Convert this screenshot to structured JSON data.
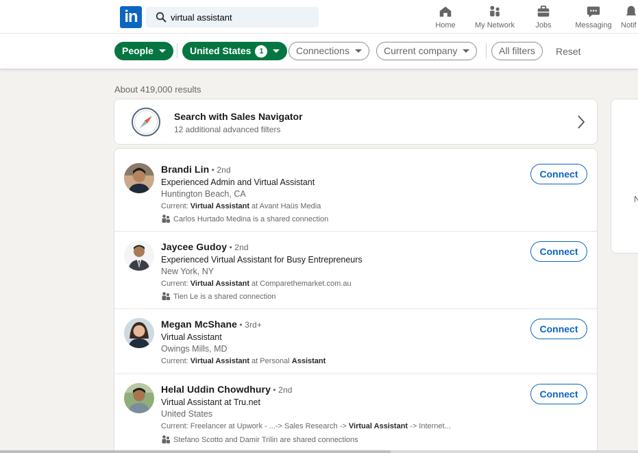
{
  "nav": {
    "logo": "in",
    "search_value": "virtual assistant",
    "items": [
      {
        "label": "Home",
        "icon": "home-icon"
      },
      {
        "label": "My Network",
        "icon": "network-icon"
      },
      {
        "label": "Jobs",
        "icon": "briefcase-icon"
      },
      {
        "label": "Messaging",
        "icon": "messaging-icon"
      },
      {
        "label": "Notif",
        "icon": "bell-icon"
      }
    ]
  },
  "filters": {
    "people": "People",
    "location": "United States",
    "location_count": "1",
    "connections": "Connections",
    "current_company": "Current company",
    "all_filters": "All filters",
    "reset": "Reset"
  },
  "results_count": "About 419,000 results",
  "sales_navigator": {
    "title": "Search with Sales Navigator",
    "subtitle": "12 additional advanced filters"
  },
  "right_card": {
    "text": "N"
  },
  "results": [
    {
      "name": "Brandi Lin",
      "degree": " • 2nd",
      "headline": "Experienced Admin and Virtual Assistant",
      "location": "Huntington Beach, CA",
      "current_prefix": "Current: ",
      "current_bold": "Virtual Assistant",
      "current_rest": " at Avant Haüs Media",
      "shared_name": "Carlos Hurtado Medina",
      "shared_rest": " is a shared connection",
      "connect": "Connect"
    },
    {
      "name": "Jaycee Gudoy",
      "degree": " • 2nd",
      "headline": "Experienced Virtual Assistant for Busy Entrepreneurs",
      "location": "New York, NY",
      "current_prefix": "Current: ",
      "current_bold": "Virtual Assistant",
      "current_rest": " at Comparethemarket.com.au",
      "shared_name": "Tien Le",
      "shared_rest": " is a shared connection",
      "connect": "Connect"
    },
    {
      "name": "Megan McShane",
      "degree": " • 3rd+",
      "headline": "Virtual Assistant",
      "location": "Owings Mills, MD",
      "current_prefix": "Current: ",
      "current_bold": "Virtual Assistant",
      "current_mid": " at Personal ",
      "current_bold2": "Assistant",
      "connect": "Connect"
    },
    {
      "name": "Helal Uddin Chowdhury",
      "degree": " • 2nd",
      "headline": "Virtual Assistant at Tru.net",
      "location": "United States",
      "current_prefix": "Current: Freelancer at Upwork - ...-> Sales Research -> ",
      "current_bold": "Virtual Assistant",
      "current_rest": " -> Internet...",
      "shared_name": "Stefano Scotto",
      "shared_mid": " and ",
      "shared_name2": "Damir Trilin",
      "shared_rest": " are shared connections",
      "connect": "Connect"
    }
  ],
  "colors": {
    "brand": "#0a66c2",
    "filter_active": "#057642",
    "background": "#f3f2ef"
  }
}
